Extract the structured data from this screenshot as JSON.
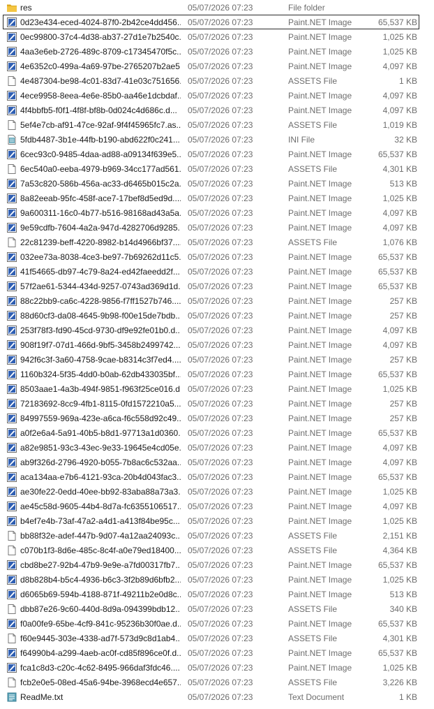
{
  "files": [
    {
      "icon": "folder-icon",
      "name": "res",
      "date": "05/07/2026 07:23",
      "type": "File folder",
      "size": ""
    },
    {
      "icon": "paint-net-image-icon",
      "name": "0d23e434-eced-4024-87f0-2b42ce4dd456...",
      "date": "05/07/2026 07:23",
      "type": "Paint.NET Image",
      "size": "65,537 KB",
      "selected": true
    },
    {
      "icon": "paint-net-image-icon",
      "name": "0ec99800-37c4-4d38-ab37-27d1e7b2540c...",
      "date": "05/07/2026 07:23",
      "type": "Paint.NET Image",
      "size": "1,025 KB"
    },
    {
      "icon": "paint-net-image-icon",
      "name": "4aa3e6eb-2726-489c-8709-c17345470f5c...",
      "date": "05/07/2026 07:23",
      "type": "Paint.NET Image",
      "size": "1,025 KB"
    },
    {
      "icon": "paint-net-image-icon",
      "name": "4e6352c0-499a-4a69-97be-2765207b2ae5...",
      "date": "05/07/2026 07:23",
      "type": "Paint.NET Image",
      "size": "4,097 KB"
    },
    {
      "icon": "blank-file-icon",
      "name": "4e487304-be98-4c01-83d7-41e03c751656...",
      "date": "05/07/2026 07:23",
      "type": "ASSETS File",
      "size": "1 KB"
    },
    {
      "icon": "paint-net-image-icon",
      "name": "4ece9958-8eea-4e6e-85b0-aa46e1dcbdaf...",
      "date": "05/07/2026 07:23",
      "type": "Paint.NET Image",
      "size": "4,097 KB"
    },
    {
      "icon": "paint-net-image-icon",
      "name": "4f4bbfb5-f0f1-4f8f-bf8b-0d024c4d686c.d...",
      "date": "05/07/2026 07:23",
      "type": "Paint.NET Image",
      "size": "4,097 KB"
    },
    {
      "icon": "blank-file-icon",
      "name": "5ef4e7cb-af91-47ce-92af-9f4f45965fc7.as...",
      "date": "05/07/2026 07:23",
      "type": "ASSETS File",
      "size": "1,019 KB"
    },
    {
      "icon": "ini-file-icon",
      "name": "5fdb4487-3b1e-44fb-b190-abd622f0c241....",
      "date": "05/07/2026 07:23",
      "type": "INI File",
      "size": "32 KB"
    },
    {
      "icon": "paint-net-image-icon",
      "name": "6cec93c0-9485-4daa-ad88-a09134f639e5...",
      "date": "05/07/2026 07:23",
      "type": "Paint.NET Image",
      "size": "65,537 KB"
    },
    {
      "icon": "blank-file-icon",
      "name": "6ec540a0-eeba-4979-b969-34cc177ad561...",
      "date": "05/07/2026 07:23",
      "type": "ASSETS File",
      "size": "4,301 KB"
    },
    {
      "icon": "paint-net-image-icon",
      "name": "7a53c820-586b-456a-ac33-d6465b015c2a...",
      "date": "05/07/2026 07:23",
      "type": "Paint.NET Image",
      "size": "513 KB"
    },
    {
      "icon": "paint-net-image-icon",
      "name": "8a82eeab-95fc-458f-ace7-17bef8d5ed9d....",
      "date": "05/07/2026 07:23",
      "type": "Paint.NET Image",
      "size": "1,025 KB"
    },
    {
      "icon": "paint-net-image-icon",
      "name": "9a600311-16c0-4b77-b516-98168ad43a5a...",
      "date": "05/07/2026 07:23",
      "type": "Paint.NET Image",
      "size": "4,097 KB"
    },
    {
      "icon": "paint-net-image-icon",
      "name": "9e59cdfb-7604-4a2a-947d-4282706d9285....",
      "date": "05/07/2026 07:23",
      "type": "Paint.NET Image",
      "size": "4,097 KB"
    },
    {
      "icon": "blank-file-icon",
      "name": "22c81239-beff-4220-8982-b14d4966bf37....",
      "date": "05/07/2026 07:23",
      "type": "ASSETS File",
      "size": "1,076 KB"
    },
    {
      "icon": "paint-net-image-icon",
      "name": "032ee73a-8038-4ce3-be97-7b69262d11c5...",
      "date": "05/07/2026 07:23",
      "type": "Paint.NET Image",
      "size": "65,537 KB"
    },
    {
      "icon": "paint-net-image-icon",
      "name": "41f54665-db97-4c79-8a24-ed42faeedd2f....",
      "date": "05/07/2026 07:23",
      "type": "Paint.NET Image",
      "size": "65,537 KB"
    },
    {
      "icon": "paint-net-image-icon",
      "name": "57f2ae61-5344-434d-9257-0743ad369d1d...",
      "date": "05/07/2026 07:23",
      "type": "Paint.NET Image",
      "size": "65,537 KB"
    },
    {
      "icon": "paint-net-image-icon",
      "name": "88c22bb9-ca6c-4228-9856-f7ff1527b746....",
      "date": "05/07/2026 07:23",
      "type": "Paint.NET Image",
      "size": "257 KB"
    },
    {
      "icon": "paint-net-image-icon",
      "name": "88d60cf3-da08-4645-9b98-f00e15de7bdb...",
      "date": "05/07/2026 07:23",
      "type": "Paint.NET Image",
      "size": "257 KB"
    },
    {
      "icon": "paint-net-image-icon",
      "name": "253f78f3-fd90-45cd-9730-df9e92fe01b0.d...",
      "date": "05/07/2026 07:23",
      "type": "Paint.NET Image",
      "size": "4,097 KB"
    },
    {
      "icon": "paint-net-image-icon",
      "name": "908f19f7-07d1-466d-9bf5-3458b2499742....",
      "date": "05/07/2026 07:23",
      "type": "Paint.NET Image",
      "size": "4,097 KB"
    },
    {
      "icon": "paint-net-image-icon",
      "name": "942f6c3f-3a60-4758-9cae-b8314c3f7ed4....",
      "date": "05/07/2026 07:23",
      "type": "Paint.NET Image",
      "size": "257 KB"
    },
    {
      "icon": "paint-net-image-icon",
      "name": "1160b324-5f35-4dd0-b0ab-62db433035bf...",
      "date": "05/07/2026 07:23",
      "type": "Paint.NET Image",
      "size": "65,537 KB"
    },
    {
      "icon": "paint-net-image-icon",
      "name": "8503aae1-4a3b-494f-9851-f963f25ce016.d...",
      "date": "05/07/2026 07:23",
      "type": "Paint.NET Image",
      "size": "1,025 KB"
    },
    {
      "icon": "paint-net-image-icon",
      "name": "72183692-8cc9-4fb1-8115-0fd1572210a5....",
      "date": "05/07/2026 07:23",
      "type": "Paint.NET Image",
      "size": "257 KB"
    },
    {
      "icon": "paint-net-image-icon",
      "name": "84997559-969a-423e-a6ca-f6c558d92c49....",
      "date": "05/07/2026 07:23",
      "type": "Paint.NET Image",
      "size": "257 KB"
    },
    {
      "icon": "paint-net-image-icon",
      "name": "a0f2e6a4-5a91-40b5-b8d1-97713a1d0360....",
      "date": "05/07/2026 07:23",
      "type": "Paint.NET Image",
      "size": "65,537 KB"
    },
    {
      "icon": "paint-net-image-icon",
      "name": "a82e9851-93c3-43ec-9e33-19645e4cd05e....",
      "date": "05/07/2026 07:23",
      "type": "Paint.NET Image",
      "size": "4,097 KB"
    },
    {
      "icon": "paint-net-image-icon",
      "name": "ab9f326d-2796-4920-b055-7b8ac6c532aa....",
      "date": "05/07/2026 07:23",
      "type": "Paint.NET Image",
      "size": "4,097 KB"
    },
    {
      "icon": "paint-net-image-icon",
      "name": "aca134aa-e7b6-4121-93ca-20b4d043fac3....",
      "date": "05/07/2026 07:23",
      "type": "Paint.NET Image",
      "size": "65,537 KB"
    },
    {
      "icon": "paint-net-image-icon",
      "name": "ae30fe22-0edd-40ee-bb92-83aba88a73a3....",
      "date": "05/07/2026 07:23",
      "type": "Paint.NET Image",
      "size": "1,025 KB"
    },
    {
      "icon": "paint-net-image-icon",
      "name": "ae45c58d-9605-44b4-8d7a-fc6355106517....",
      "date": "05/07/2026 07:23",
      "type": "Paint.NET Image",
      "size": "4,097 KB"
    },
    {
      "icon": "paint-net-image-icon",
      "name": "b4ef7e4b-73af-47a2-a4d1-a413f84be95c....",
      "date": "05/07/2026 07:23",
      "type": "Paint.NET Image",
      "size": "1,025 KB"
    },
    {
      "icon": "blank-file-icon",
      "name": "bb88f32e-adef-447b-9d07-4a12aa24093c....",
      "date": "05/07/2026 07:23",
      "type": "ASSETS File",
      "size": "2,151 KB"
    },
    {
      "icon": "blank-file-icon",
      "name": "c070b1f3-8d6e-485c-8c4f-a0e79ed18400....",
      "date": "05/07/2026 07:23",
      "type": "ASSETS File",
      "size": "4,364 KB"
    },
    {
      "icon": "paint-net-image-icon",
      "name": "cbd8be27-92b4-47b9-9e9e-a7fd00317fb7....",
      "date": "05/07/2026 07:23",
      "type": "Paint.NET Image",
      "size": "65,537 KB"
    },
    {
      "icon": "paint-net-image-icon",
      "name": "d8b828b4-b5c4-4936-b6c3-3f2b89d6bfb2....",
      "date": "05/07/2026 07:23",
      "type": "Paint.NET Image",
      "size": "1,025 KB"
    },
    {
      "icon": "paint-net-image-icon",
      "name": "d6065b69-594b-4188-871f-49211b2e0d8c....",
      "date": "05/07/2026 07:23",
      "type": "Paint.NET Image",
      "size": "513 KB"
    },
    {
      "icon": "blank-file-icon",
      "name": "dbb87e26-9c60-440d-8d9a-094399bdb12....",
      "date": "05/07/2026 07:23",
      "type": "ASSETS File",
      "size": "340 KB"
    },
    {
      "icon": "paint-net-image-icon",
      "name": "f0a00fe9-65be-4cf9-841c-95236b30f0ae.d...",
      "date": "05/07/2026 07:23",
      "type": "Paint.NET Image",
      "size": "65,537 KB"
    },
    {
      "icon": "blank-file-icon",
      "name": "f60e9445-303e-4338-ad7f-573d9c8d1ab4....",
      "date": "05/07/2026 07:23",
      "type": "ASSETS File",
      "size": "4,301 KB"
    },
    {
      "icon": "paint-net-image-icon",
      "name": "f64990b4-a299-4aeb-ac0f-cd85f896ce0f.d...",
      "date": "05/07/2026 07:23",
      "type": "Paint.NET Image",
      "size": "65,537 KB"
    },
    {
      "icon": "paint-net-image-icon",
      "name": "fca1c8d3-c20c-4c62-8495-966daf3fdc46....",
      "date": "05/07/2026 07:23",
      "type": "Paint.NET Image",
      "size": "1,025 KB"
    },
    {
      "icon": "blank-file-icon",
      "name": "fcb2e0e5-08ed-45a6-94be-3968ecd4e657....",
      "date": "05/07/2026 07:23",
      "type": "ASSETS File",
      "size": "3,226 KB"
    },
    {
      "icon": "text-document-icon",
      "name": "ReadMe.txt",
      "date": "05/07/2026 07:23",
      "type": "Text Document",
      "size": "1 KB"
    }
  ],
  "colors": {
    "folder": "#f4c542",
    "folder_dark": "#dca91f",
    "paint_blue": "#2f5fb3",
    "paint_frame": "#6a6a6a",
    "ini_teal": "#5aa3b8",
    "text_secondary": "#6d6d6d",
    "selection_border": "#2b2b2b"
  }
}
